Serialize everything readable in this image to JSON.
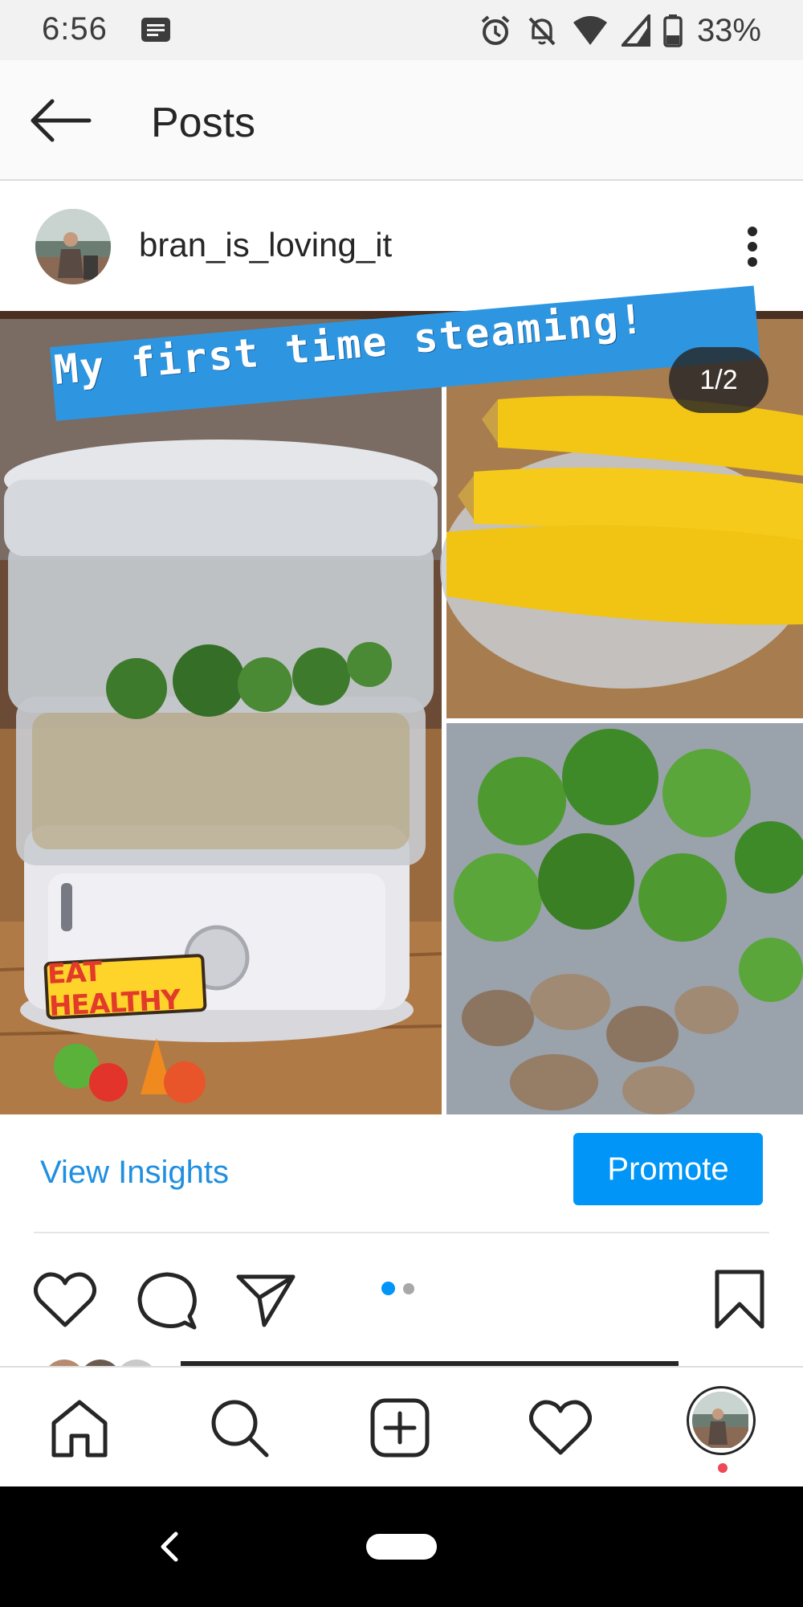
{
  "status_bar": {
    "time": "6:56",
    "battery": "33%",
    "icons": [
      "message-icon",
      "alarm-icon",
      "notifications-off-icon",
      "wifi-icon",
      "signal-icon",
      "battery-icon"
    ]
  },
  "header": {
    "title": "Posts",
    "back_icon": "arrow-left-icon"
  },
  "post": {
    "username": "bran_is_loving_it",
    "image_caption": "My first time steaming!",
    "page_counter": "1/2",
    "sticker_text": "EAT HEALTHY",
    "view_insights": "View Insights",
    "promote": "Promote",
    "carousel_index": 0,
    "carousel_count": 2
  },
  "colors": {
    "accent": "#0095f6",
    "link": "#1f8fe0",
    "notification": "#ed4956",
    "caption_banner": "#2e96e0"
  },
  "bottom_nav": [
    "home-icon",
    "search-icon",
    "add-post-icon",
    "activity-heart-icon",
    "profile-avatar"
  ]
}
